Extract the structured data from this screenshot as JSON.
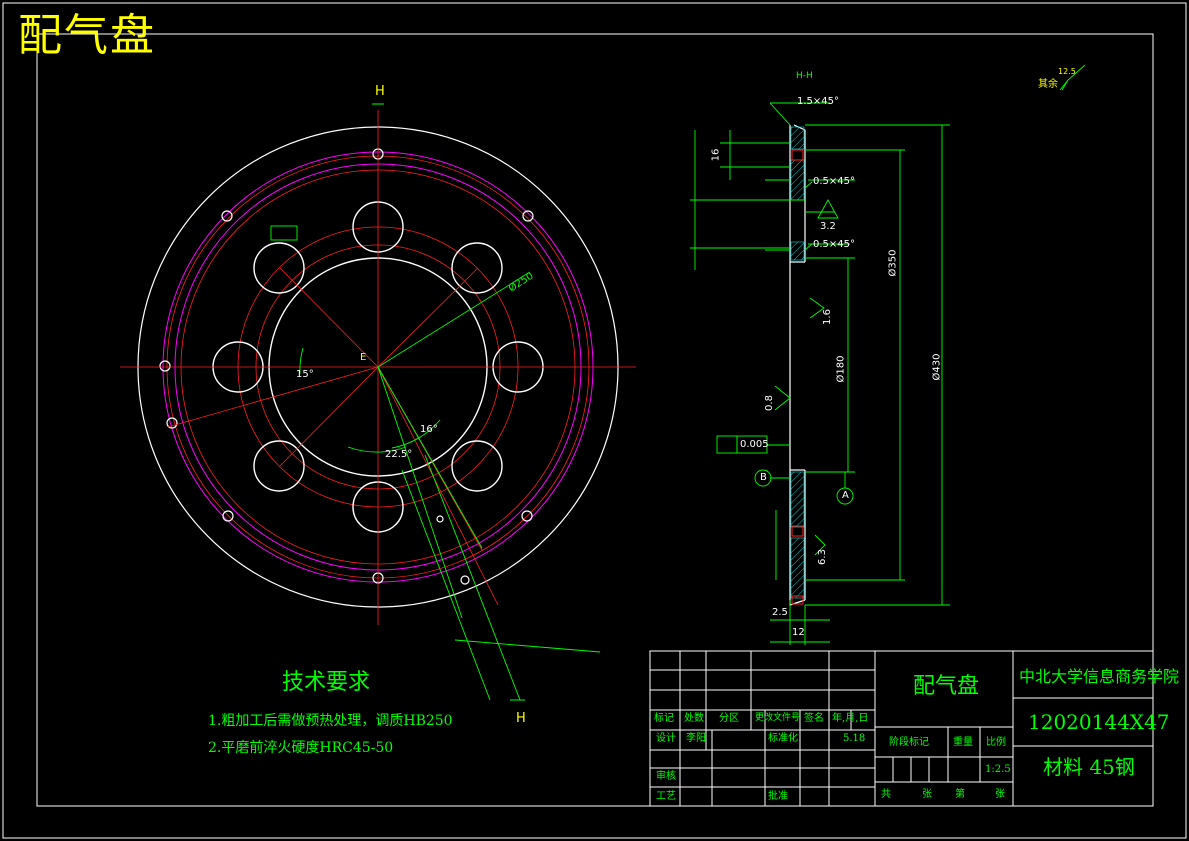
{
  "drawing": {
    "title_big": "配气盘",
    "section_label": "H-H",
    "cut_marker": "H",
    "center_marker": "E",
    "roughness_other": "其余",
    "roughness_other_value": "12.5"
  },
  "front_view": {
    "dims": {
      "dia_250": "Ø250",
      "angle_15": "15°",
      "angle_16": "16°",
      "angle_22_5": "22.5°"
    }
  },
  "section_view": {
    "chamfer_top": "1.5×45°",
    "chamfer_mid1": "0.5×45°",
    "chamfer_mid2": "0.5×45°",
    "roughness_3_2": "3.2",
    "roughness_1_6": "1.6",
    "roughness_0_8": "0.8",
    "roughness_6_3": "6.3",
    "dim_16": "16",
    "dim_350": "Ø350",
    "dim_430": "Ø430",
    "dim_180": "Ø180",
    "flatness": "0.005",
    "datum_b": "B",
    "datum_a": "A",
    "dim_2_5": "2.5",
    "dim_12": "12"
  },
  "tech_req": {
    "title": "技术要求",
    "line1": "1.粗加工后需做预热处理，调质HB250",
    "line2": "2.平磨前淬火硬度HRC45-50"
  },
  "title_block": {
    "part_name": "配气盘",
    "school": "中北大学信息商务学院",
    "drawing_no": "12020144X47",
    "material": "材料 45钢",
    "scale": "1:2.5",
    "hdr_mark": "标记",
    "hdr_count": "处数",
    "hdr_zone": "分区",
    "hdr_doc": "更改文件号",
    "hdr_sign": "签名",
    "hdr_date": "年,月,日",
    "design": "设计",
    "designer": "李阳",
    "standard": "标准化",
    "date": "5.18",
    "stage": "阶段标记",
    "weight": "重量",
    "ratio": "比例",
    "review": "审核",
    "process": "工艺",
    "approve": "批准",
    "total": "共",
    "sheet": "张",
    "no": "第",
    "sheet2": "张"
  }
}
